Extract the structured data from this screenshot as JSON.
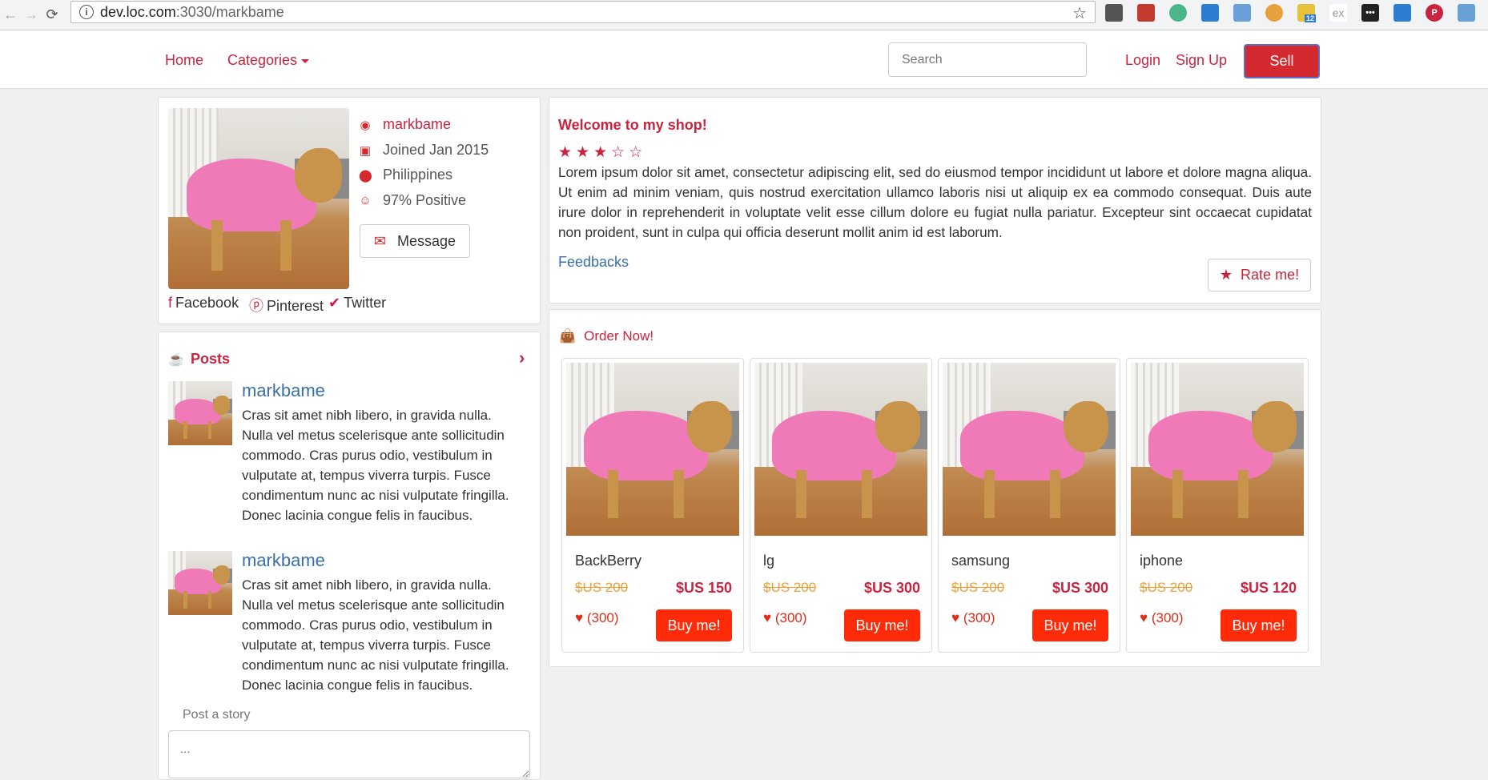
{
  "browser": {
    "host": "dev.loc.com",
    "path": ":3030/markbame",
    "ext_labels": [
      "ex",
      "12"
    ]
  },
  "nav": {
    "home": "Home",
    "categories": "Categories",
    "search_placeholder": "Search",
    "login": "Login",
    "signup": "Sign Up",
    "sell": "Sell"
  },
  "profile": {
    "username": "markbame",
    "joined": "Joined Jan 2015",
    "location": "Philippines",
    "rating": "97% Positive",
    "message_label": "Message",
    "social": [
      "Facebook",
      "Pinterest",
      "Twitter"
    ]
  },
  "posts": {
    "title": "Posts",
    "items": [
      {
        "author": "markbame",
        "text": "Cras sit amet nibh libero, in gravida nulla. Nulla vel metus scelerisque ante sollicitudin commodo. Cras purus odio, vestibulum in vulputate at, tempus viverra turpis. Fusce condimentum nunc ac nisi vulputate fringilla. Donec lacinia congue felis in faucibus."
      },
      {
        "author": "markbame",
        "text": "Cras sit amet nibh libero, in gravida nulla. Nulla vel metus scelerisque ante sollicitudin commodo. Cras purus odio, vestibulum in vulputate at, tempus viverra turpis. Fusce condimentum nunc ac nisi vulputate fringilla. Donec lacinia congue felis in faucibus."
      }
    ],
    "post_story_label": "Post a story",
    "story_placeholder": "..."
  },
  "shop": {
    "welcome": "Welcome to my shop!",
    "stars_filled": 3,
    "stars_total": 5,
    "stars_text": "★★★☆☆",
    "description": "Lorem ipsum dolor sit amet, consectetur adipiscing elit, sed do eiusmod tempor incididunt ut labore et dolore magna aliqua. Ut enim ad minim veniam, quis nostrud exercitation ullamco laboris nisi ut aliquip ex ea commodo consequat. Duis aute irure dolor in reprehenderit in voluptate velit esse cillum dolore eu fugiat nulla pariatur. Excepteur sint occaecat cupidatat non proident, sunt in culpa qui officia deserunt mollit anim id est laborum.",
    "feedbacks": "Feedbacks",
    "rate_label": "Rate me!"
  },
  "order": {
    "title": "Order Now!",
    "products": [
      {
        "name": "BackBerry",
        "old_price": "$US 200",
        "price": "$US 150",
        "likes": "(300)",
        "buy": "Buy me!"
      },
      {
        "name": "lg",
        "old_price": "$US 200",
        "price": "$US 300",
        "likes": "(300)",
        "buy": "Buy me!"
      },
      {
        "name": "samsung",
        "old_price": "$US 200",
        "price": "$US 300",
        "likes": "(300)",
        "buy": "Buy me!"
      },
      {
        "name": "iphone",
        "old_price": "$US 200",
        "price": "$US 120",
        "likes": "(300)",
        "buy": "Buy me!"
      }
    ]
  },
  "colors": {
    "brand": "#c9243f",
    "buy": "#ff2a08",
    "link": "#3a6fa8",
    "old_price": "#e8a13a"
  }
}
